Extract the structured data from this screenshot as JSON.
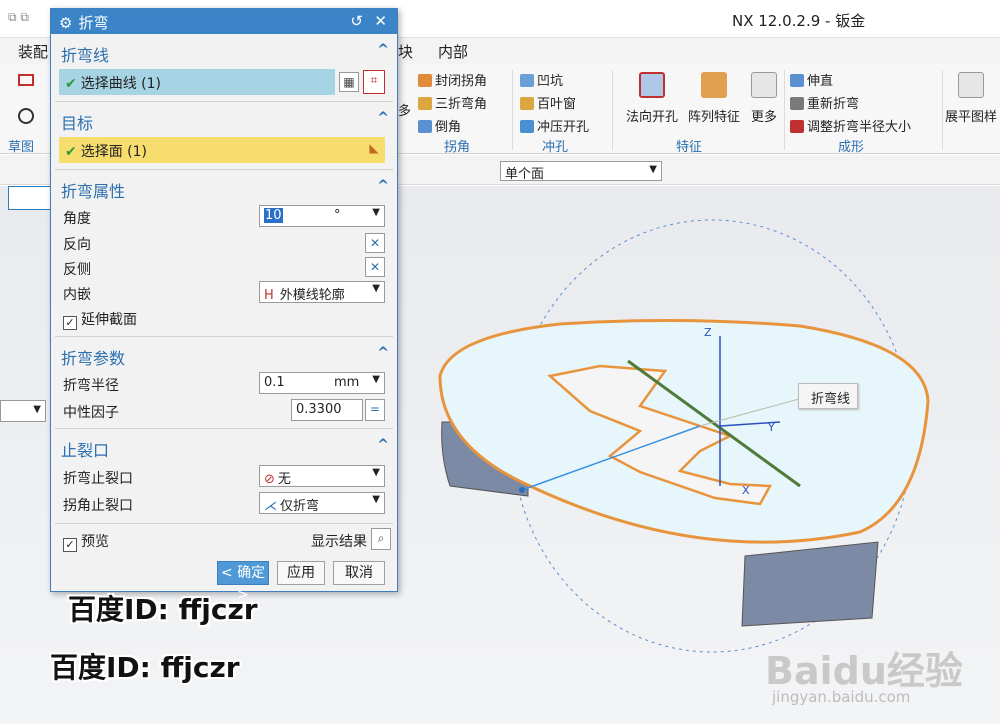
{
  "app": {
    "title": "NX 12.0.2.9 - 钣金"
  },
  "menubar": {
    "items": [
      "装配",
      "块",
      "内部"
    ]
  },
  "ribbon": {
    "corner_group": {
      "items": [
        "封闭拐角",
        "三折弯角",
        "倒角"
      ],
      "label": "拐角"
    },
    "punch_group": {
      "items": [
        "凹坑",
        "百叶窗",
        "冲压开孔"
      ],
      "label": "冲孔"
    },
    "feature_group": {
      "items": [
        "法向开孔",
        "阵列特征",
        "更多"
      ],
      "label": "特征"
    },
    "forming_group": {
      "items": [
        "伸直",
        "重新折弯",
        "调整折弯半径大小"
      ],
      "label": "成形"
    },
    "flat_btn": "展平图样",
    "sketch_label": "草图",
    "partial_more": "多"
  },
  "selection": {
    "filter": "单个面"
  },
  "viewport": {
    "callout": "折弯线"
  },
  "dialog": {
    "title": "折弯",
    "sec_bendline": "折弯线",
    "select_curve": "选择曲线 (1)",
    "sec_target": "目标",
    "select_face": "选择面 (1)",
    "sec_props": "折弯属性",
    "angle_label": "角度",
    "angle_value": "10",
    "angle_unit": "°",
    "reverse_label": "反向",
    "flip_side_label": "反侧",
    "inset_label": "内嵌",
    "inset_value": "外模线轮廓",
    "extend_label": "延伸截面",
    "sec_params": "折弯参数",
    "radius_label": "折弯半径",
    "radius_value": "0.1",
    "radius_unit": "mm",
    "kfactor_label": "中性因子",
    "kfactor_value": "0.3300",
    "sec_relief": "止裂口",
    "bend_relief_label": "折弯止裂口",
    "bend_relief_value": "无",
    "corner_relief_label": "拐角止裂口",
    "corner_relief_value": "仅折弯",
    "preview_label": "预览",
    "show_result": "显示结果",
    "ok": "< 确定 >",
    "apply": "应用",
    "cancel": "取消"
  },
  "watermark": {
    "line1": "百度ID: ffjczr",
    "line2": "百度ID: ffjczr",
    "brand": "Baidu经验",
    "brand_url": "jingyan.baidu.com"
  }
}
